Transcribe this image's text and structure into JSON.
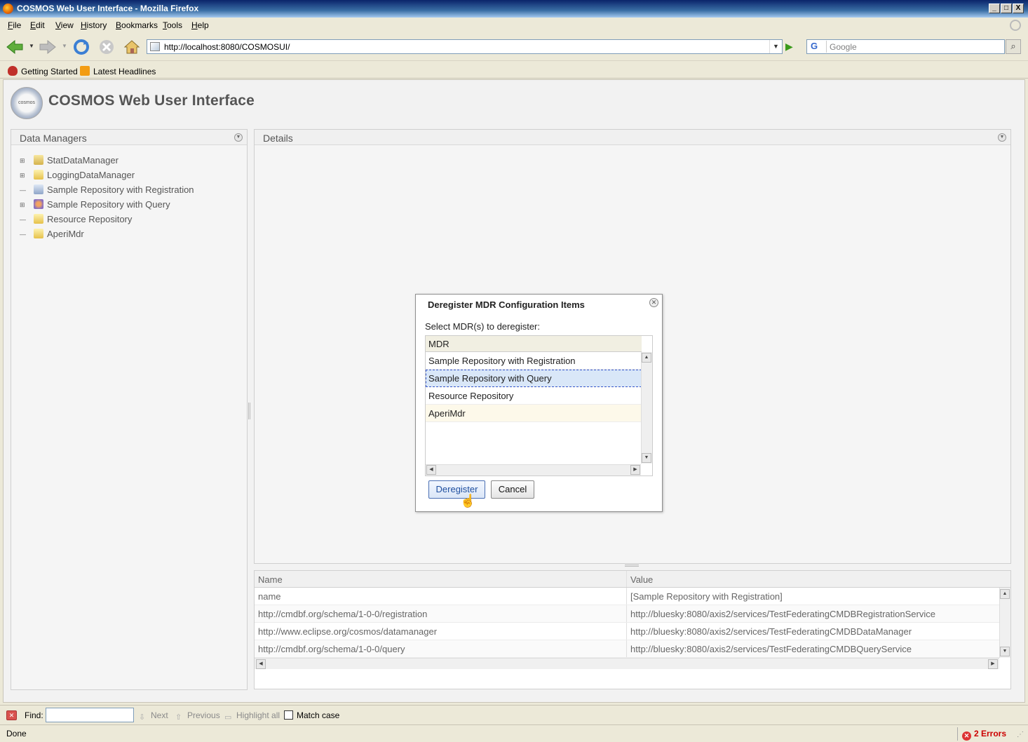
{
  "window": {
    "title": "COSMOS Web User Interface - Mozilla Firefox",
    "minimize": "_",
    "maximize": "□",
    "close": "X"
  },
  "menu": [
    "File",
    "Edit",
    "View",
    "History",
    "Bookmarks",
    "Tools",
    "Help"
  ],
  "nav": {
    "url": "http://localhost:8080/COSMOSUI/",
    "search_placeholder": "Google",
    "search_engine": "G"
  },
  "bookmarks": [
    "Getting Started",
    "Latest Headlines"
  ],
  "app": {
    "title": "COSMOS Web User Interface",
    "logo_text": "cosmos"
  },
  "data_managers": {
    "title": "Data Managers",
    "nodes": [
      {
        "label": "StatDataManager",
        "expandable": true,
        "icon": "stat-icon"
      },
      {
        "label": "LoggingDataManager",
        "expandable": true,
        "icon": "database-icon"
      },
      {
        "label": "Sample Repository with Registration",
        "expandable": false,
        "icon": "repository-icon"
      },
      {
        "label": "Sample Repository with Query",
        "expandable": true,
        "icon": "users-icon"
      },
      {
        "label": "Resource Repository",
        "expandable": false,
        "icon": "database-icon"
      },
      {
        "label": "AperiMdr",
        "expandable": false,
        "icon": "database-icon"
      }
    ]
  },
  "details": {
    "title": "Details",
    "columns": [
      "Name",
      "Value"
    ],
    "rows": [
      [
        "name",
        "[Sample Repository with Registration]"
      ],
      [
        "http://cmdbf.org/schema/1-0-0/registration",
        "http://bluesky:8080/axis2/services/TestFederatingCMDBRegistrationService"
      ],
      [
        "http://www.eclipse.org/cosmos/datamanager",
        "http://bluesky:8080/axis2/services/TestFederatingCMDBDataManager"
      ],
      [
        "http://cmdbf.org/schema/1-0-0/query",
        "http://bluesky:8080/axis2/services/TestFederatingCMDBQueryService"
      ]
    ]
  },
  "dialog": {
    "title": "Deregister MDR Configuration Items",
    "prompt": "Select MDR(s) to deregister:",
    "column": "MDR",
    "items": [
      "Sample Repository with Registration",
      "Sample Repository with Query",
      "Resource Repository",
      "AperiMdr"
    ],
    "selected_index": 1,
    "deregister_label": "Deregister",
    "cancel_label": "Cancel"
  },
  "findbar": {
    "label": "Find:",
    "next": "Next",
    "previous": "Previous",
    "highlight": "Highlight all",
    "match_case": "Match case"
  },
  "status": {
    "text": "Done",
    "errors": "2 Errors"
  }
}
